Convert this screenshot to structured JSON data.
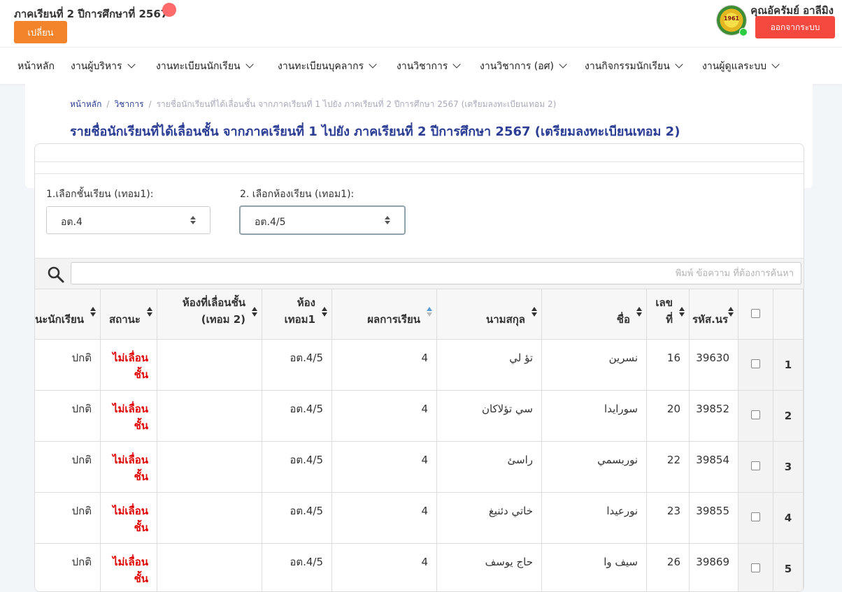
{
  "header": {
    "term_title": "ภาคเรียนที่ 2 ปีการศึกษาที่ 2567",
    "change_label": "เปลี่ยน",
    "user_name": "คุณอัครัมย์ อาลีมิง",
    "logout_label": "ออกจากระบบ",
    "logo_text": "1961"
  },
  "nav": {
    "items": [
      {
        "label": "หน้าหลัก"
      },
      {
        "label": "งานผู้บริหาร"
      },
      {
        "label": "งานทะเบียนนักเรียน"
      },
      {
        "label": "งานทะเบียนบุคลากร"
      },
      {
        "label": "งานวิชาการ"
      },
      {
        "label": "งานวิชาการ (อศ)"
      },
      {
        "label": "งานกิจกรรมนักเรียน"
      },
      {
        "label": "งานผู้ดูแลระบบ"
      }
    ]
  },
  "breadcrumb": {
    "home": "หน้าหลัก",
    "section": "วิชาการ",
    "current": "รายชื่อนักเรียนที่ได้เลื่อนชั้น จากภาคเรียนที่ 1 ไปยัง ภาคเรียนที่ 2 ปีการศึกษา 2567 (เตรียมลงทะเบียนเทอม 2)"
  },
  "page_title": "รายชื่อนักเรียนที่ได้เลื่อนชั้น จากภาคเรียนที่ 1 ไปยัง ภาคเรียนที่ 2 ปีการศึกษา 2567 (เตรียมลงทะเบียนเทอม 2)",
  "form": {
    "class_label": "1.เลือกชั้นเรียน (เทอม1):",
    "class_value": "อต.4",
    "room_label": "2. เลือกห้องเรียน (เทอม1):",
    "room_value": "อต.4/5"
  },
  "search": {
    "placeholder": "พิมพ์ ข้อความ ที่ต้องการค้นหา"
  },
  "table": {
    "headers": {
      "student_status": "สถานะนักเรียน",
      "status": "สถานะ",
      "promoted_room": "ห้องที่เลื่อนชั้น (เทอม 2)",
      "room_term1": "ห้อง เทอม1",
      "result": "ผลการเรียน",
      "surname": "นามสกุล",
      "first_name": "ชื่อ",
      "number": "เลขที่",
      "student_id": "รหัส.นร"
    },
    "rows": [
      {
        "index": "1",
        "student_id": "39630",
        "number": "16",
        "first_name": "نسرين",
        "surname": "تؤ لي",
        "result": "4",
        "room_term1": "อต.4/5",
        "promoted_room": "",
        "status": "ไม่เลื่อนชั้น",
        "student_status": "ปกติ"
      },
      {
        "index": "2",
        "student_id": "39852",
        "number": "20",
        "first_name": "سورايدا",
        "surname": "سي تؤلاكان",
        "result": "4",
        "room_term1": "อต.4/5",
        "promoted_room": "",
        "status": "ไม่เลื่อนชั้น",
        "student_status": "ปกติ"
      },
      {
        "index": "3",
        "student_id": "39854",
        "number": "22",
        "first_name": "نوربسمي",
        "surname": "راسئ",
        "result": "4",
        "room_term1": "อต.4/5",
        "promoted_room": "",
        "status": "ไม่เลื่อนชั้น",
        "student_status": "ปกติ"
      },
      {
        "index": "4",
        "student_id": "39855",
        "number": "23",
        "first_name": "نورعيدا",
        "surname": "خاتي دئنيغ",
        "result": "4",
        "room_term1": "อต.4/5",
        "promoted_room": "",
        "status": "ไม่เลื่อนชั้น",
        "student_status": "ปกติ"
      },
      {
        "index": "5",
        "student_id": "39869",
        "number": "26",
        "first_name": "سيف وا",
        "surname": "حاج يوسف",
        "result": "4",
        "room_term1": "อต.4/5",
        "promoted_room": "",
        "status": "ไม่เลื่อนชั้น",
        "student_status": "ปกติ"
      }
    ]
  },
  "colors": {
    "accent_orange": "#f4842b",
    "logout_red": "#f5483f",
    "title_blue": "#2c3e94",
    "status_red": "#e00000"
  }
}
